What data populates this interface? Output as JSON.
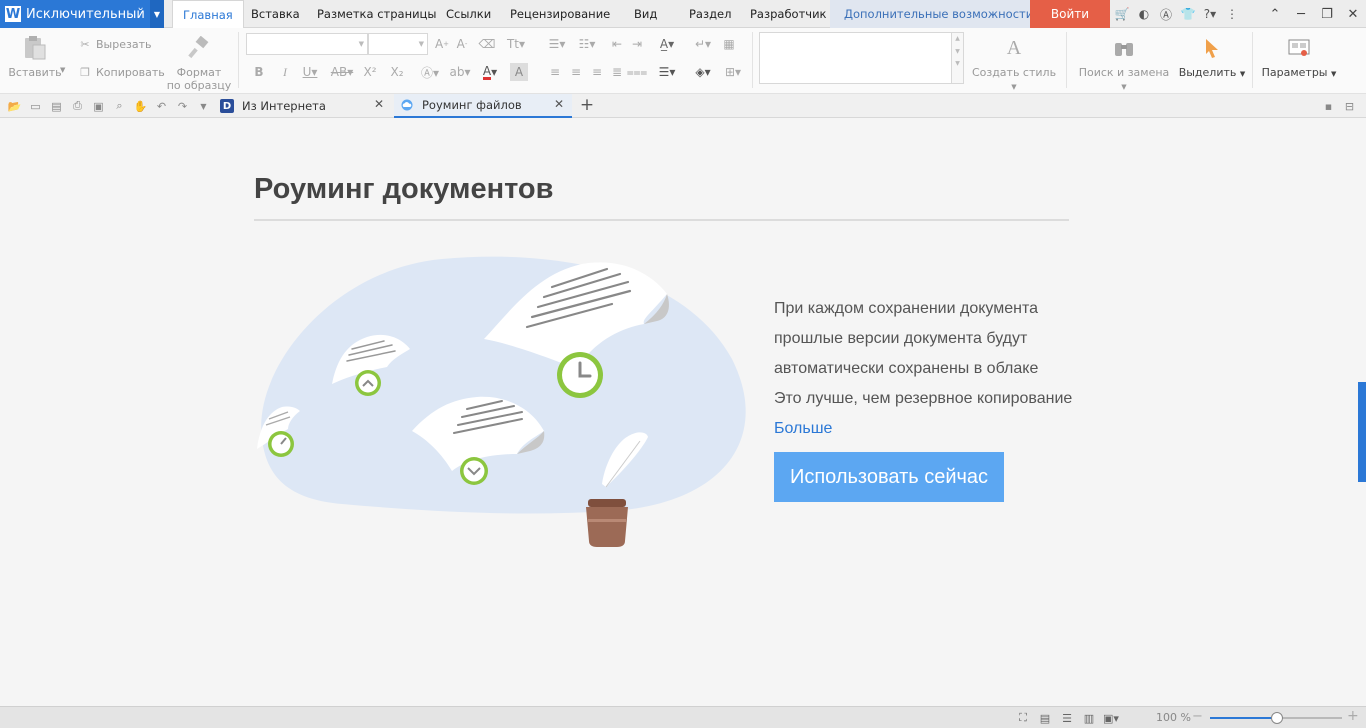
{
  "app": {
    "name": "Исключительный",
    "logo_letter": "W"
  },
  "menu_tabs": [
    {
      "label": "Главная",
      "active": true
    },
    {
      "label": "Вставка"
    },
    {
      "label": "Разметка страницы"
    },
    {
      "label": "Ссылки"
    },
    {
      "label": "Рецензирование"
    },
    {
      "label": "Вид"
    },
    {
      "label": "Раздел"
    },
    {
      "label": "Разработчик"
    },
    {
      "label": "Дополнительные возможности"
    }
  ],
  "login_label": "Войти",
  "ribbon": {
    "paste": "Вставить",
    "cut": "Вырезать",
    "copy": "Копировать",
    "format_painter_1": "Формат",
    "format_painter_2": "по образцу",
    "create_style": "Создать стиль",
    "find_replace": "Поиск и замена",
    "select": "Выделить",
    "options": "Параметры",
    "font_name": "",
    "font_size": ""
  },
  "doc_tabs": [
    {
      "label": "Из Интернета",
      "active": false,
      "icon": "d-logo-icon"
    },
    {
      "label": "Роуминг файлов",
      "active": true,
      "icon": "cloud-icon"
    }
  ],
  "main": {
    "title": "Роуминг документов",
    "lines": [
      "При каждом сохранении документа",
      "прошлые версии документа будут",
      "автоматически сохранены в облаке",
      "Это лучше, чем резервное копирование"
    ],
    "more": "Больше",
    "button": "Использовать сейчас"
  },
  "status": {
    "zoom": "100 %",
    "zoom_fraction": 0.5
  },
  "colors": {
    "accent": "#2b78d6",
    "login": "#e55f47",
    "button": "#5ca7f2",
    "blob": "#dde7f5",
    "clock": "#8cc63f"
  }
}
